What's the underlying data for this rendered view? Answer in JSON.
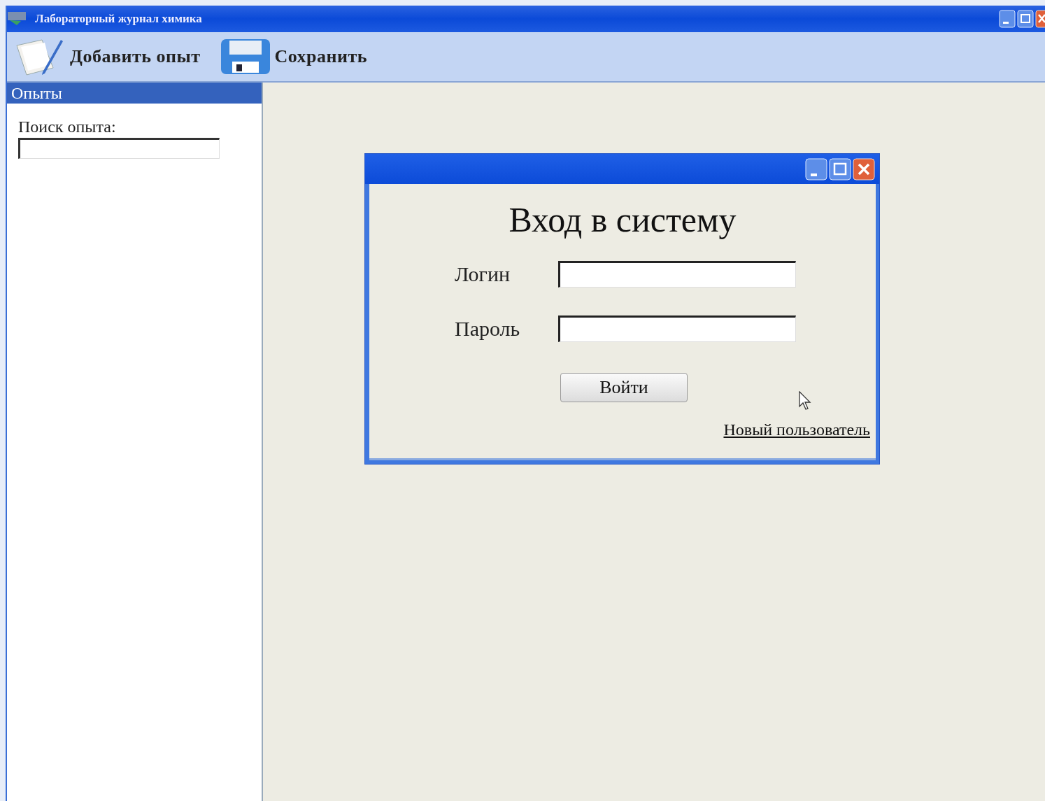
{
  "window": {
    "title": "Лабораторный журнал химика"
  },
  "toolbar": [
    {
      "kind": "add",
      "label": "Добавить опыт"
    },
    {
      "kind": "save",
      "label": "Сохранить"
    }
  ],
  "sidebar": {
    "header": "Опыты",
    "search_label": "Поиск опыта:"
  },
  "dialog": {
    "heading": "Вход в систему",
    "fields": [
      {
        "label": "Логин"
      },
      {
        "label": "Пароль"
      }
    ],
    "button": "Войти",
    "link": "Новый пользователь"
  }
}
